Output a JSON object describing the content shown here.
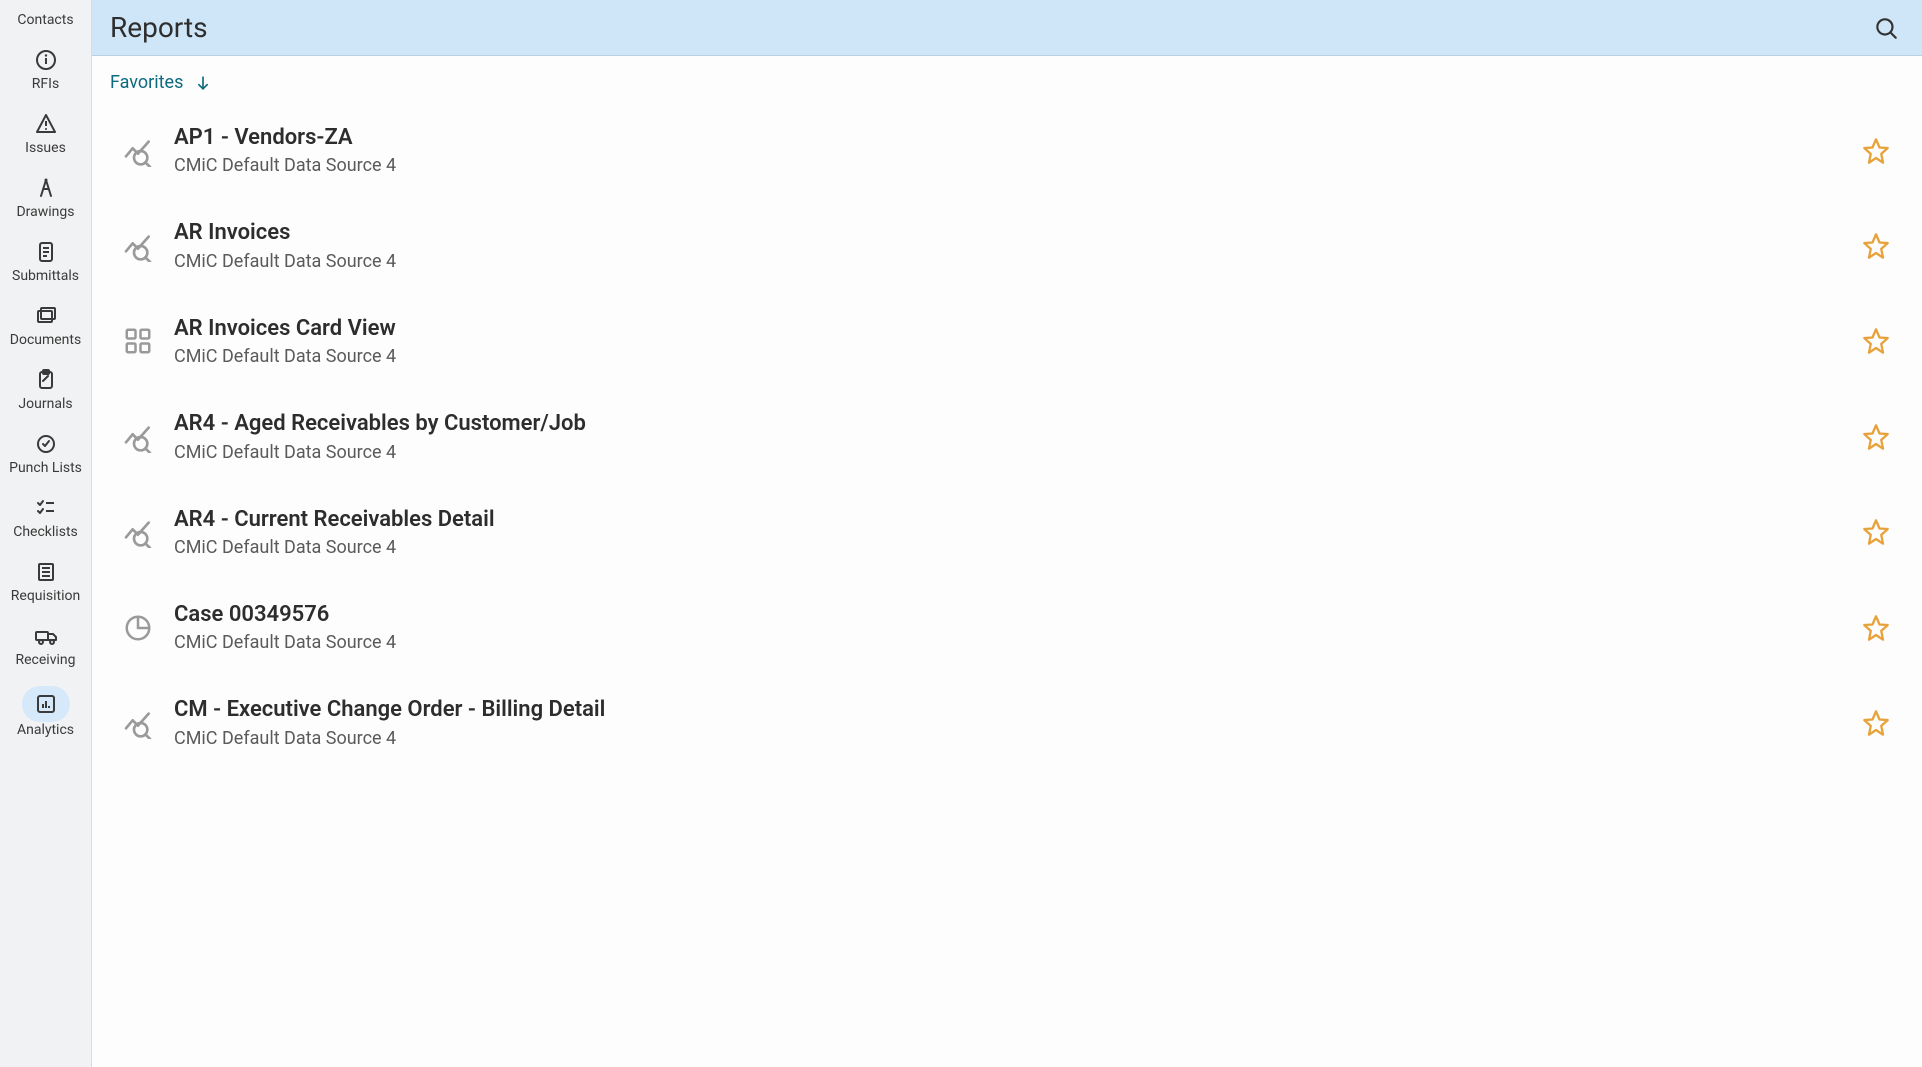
{
  "sidebar": {
    "items": [
      {
        "label": "Contacts",
        "icon": ""
      },
      {
        "label": "RFIs",
        "icon": "info"
      },
      {
        "label": "Issues",
        "icon": "warning"
      },
      {
        "label": "Drawings",
        "icon": "compass"
      },
      {
        "label": "Submittals",
        "icon": "document"
      },
      {
        "label": "Documents",
        "icon": "folders"
      },
      {
        "label": "Journals",
        "icon": "clipboard"
      },
      {
        "label": "Punch Lists",
        "icon": "target"
      },
      {
        "label": "Checklists",
        "icon": "checklist"
      },
      {
        "label": "Requisition",
        "icon": "receipt"
      },
      {
        "label": "Receiving",
        "icon": "truck"
      },
      {
        "label": "Analytics",
        "icon": "bar-chart",
        "active": true
      }
    ]
  },
  "header": {
    "title": "Reports"
  },
  "favorites_label": "Favorites",
  "reports": [
    {
      "title": "AP1 - Vendors-ZA",
      "source": "CMiC Default Data Source 4",
      "icon": "trend"
    },
    {
      "title": "AR Invoices",
      "source": "CMiC Default Data Source 4",
      "icon": "trend"
    },
    {
      "title": "AR Invoices Card View",
      "source": "CMiC Default Data Source 4",
      "icon": "dashboard"
    },
    {
      "title": "AR4 - Aged Receivables by Customer/Job",
      "source": "CMiC Default Data Source 4",
      "icon": "trend"
    },
    {
      "title": "AR4 - Current Receivables Detail",
      "source": "CMiC Default Data Source 4",
      "icon": "trend"
    },
    {
      "title": "Case 00349576",
      "source": "CMiC Default Data Source 4",
      "icon": "pie"
    },
    {
      "title": "CM - Executive Change Order - Billing Detail",
      "source": "CMiC Default Data Source 4",
      "icon": "trend"
    }
  ]
}
